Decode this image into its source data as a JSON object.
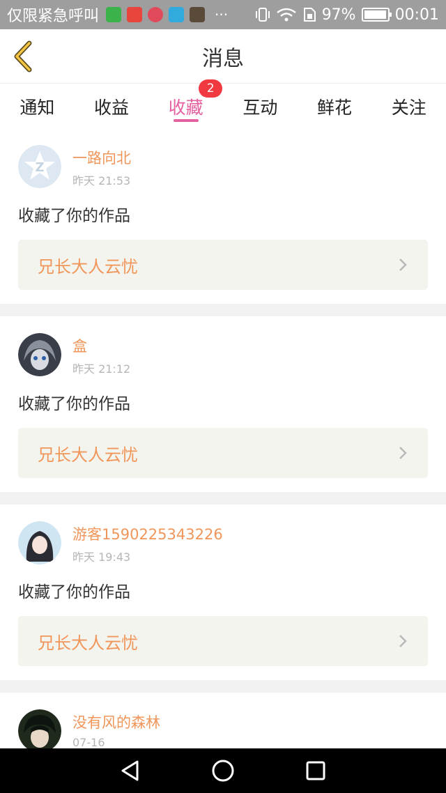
{
  "status_bar": {
    "carrier": "仅限紧急呼叫",
    "overflow": "···",
    "battery": "97%",
    "battery_level": 0.97,
    "time": "00:01",
    "app_icons": [
      "wechat-pay-icon",
      "ting-icon",
      "live-icon",
      "video-icon",
      "photo-icon"
    ]
  },
  "header": {
    "title": "消息",
    "back_icon": "chevron-left-icon",
    "accent": "#e4609e"
  },
  "tabs": [
    {
      "label": "通知",
      "active": false
    },
    {
      "label": "收益",
      "active": false
    },
    {
      "label": "收藏",
      "active": true,
      "badge": "2"
    },
    {
      "label": "互动",
      "active": false
    },
    {
      "label": "鲜花",
      "active": false
    },
    {
      "label": "关注",
      "active": false
    }
  ],
  "messages": [
    {
      "user": "一路向北",
      "time": "昨天 21:53",
      "action": "收藏了你的作品",
      "work": "兄长大人云忧",
      "avatar": "default-avatar-icon"
    },
    {
      "user": "盒",
      "time": "昨天 21:12",
      "action": "收藏了你的作品",
      "work": "兄长大人云忧",
      "avatar": "anime-avatar"
    },
    {
      "user": "游客1590225343226",
      "time": "昨天 19:43",
      "action": "收藏了你的作品",
      "work": "兄长大人云忧",
      "avatar": "girl-avatar"
    },
    {
      "user": "没有风的森林",
      "time": "07-16",
      "action": "",
      "work": "",
      "avatar": "boy-avatar"
    }
  ],
  "nav": [
    "back-triangle-icon",
    "home-circle-icon",
    "recents-square-icon"
  ],
  "colors": {
    "name": "#f0965a",
    "time": "#b5b5b5",
    "work_bg": "#f4f4ee",
    "badge": "#f03a40"
  }
}
